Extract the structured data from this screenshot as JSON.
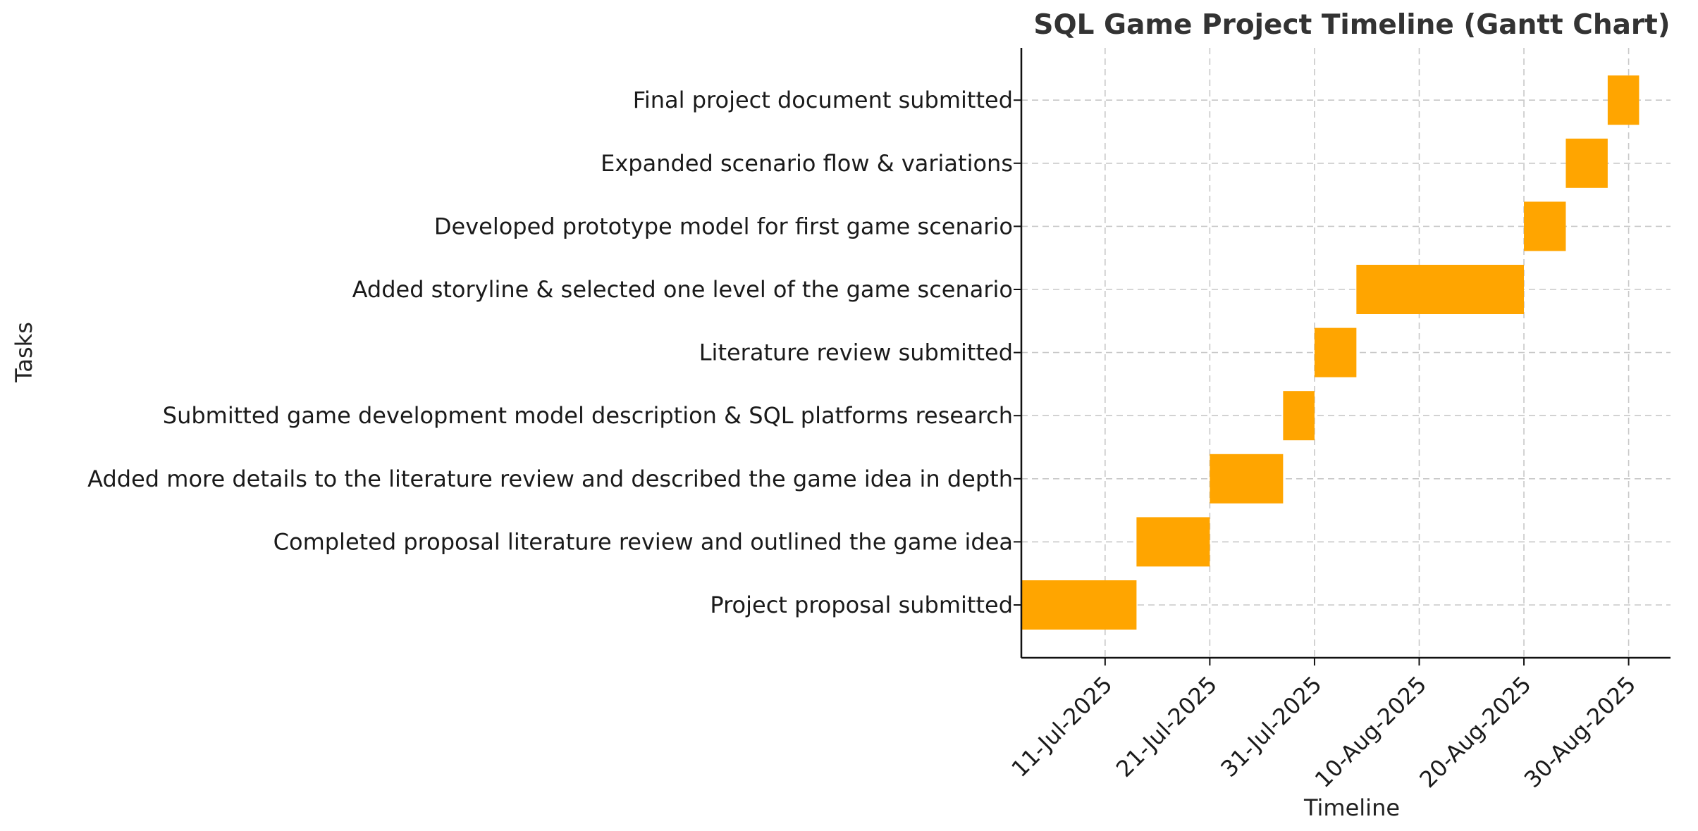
{
  "chart_data": {
    "type": "gantt",
    "title": "SQL Game Project Timeline (Gantt Chart)",
    "xlabel": "Timeline",
    "ylabel": "Tasks",
    "xlim": [
      "2025-07-03",
      "2025-09-03"
    ],
    "x_ticks": [
      {
        "date": "2025-07-11",
        "label": "11-Jul-2025"
      },
      {
        "date": "2025-07-21",
        "label": "21-Jul-2025"
      },
      {
        "date": "2025-07-31",
        "label": "31-Jul-2025"
      },
      {
        "date": "2025-08-10",
        "label": "10-Aug-2025"
      },
      {
        "date": "2025-08-20",
        "label": "20-Aug-2025"
      },
      {
        "date": "2025-08-30",
        "label": "30-Aug-2025"
      }
    ],
    "grid": true,
    "bar_color": "#FFA500",
    "tasks": [
      {
        "task": "Project proposal submitted",
        "start": "2025-07-03",
        "end": "2025-07-14"
      },
      {
        "task": "Completed proposal literature review and outlined the game idea",
        "start": "2025-07-14",
        "end": "2025-07-21"
      },
      {
        "task": "Added more details to the literature review and described the game idea in depth",
        "start": "2025-07-21",
        "end": "2025-07-28"
      },
      {
        "task": "Submitted game development model description & SQL platforms research",
        "start": "2025-07-28",
        "end": "2025-07-31"
      },
      {
        "task": "Literature review submitted",
        "start": "2025-07-31",
        "end": "2025-08-04"
      },
      {
        "task": "Added storyline & selected one level of the game scenario",
        "start": "2025-08-04",
        "end": "2025-08-20"
      },
      {
        "task": "Developed prototype model for first game scenario",
        "start": "2025-08-20",
        "end": "2025-08-24"
      },
      {
        "task": "Expanded scenario flow & variations",
        "start": "2025-08-24",
        "end": "2025-08-28"
      },
      {
        "task": "Final project document submitted",
        "start": "2025-08-28",
        "end": "2025-08-31"
      }
    ]
  }
}
